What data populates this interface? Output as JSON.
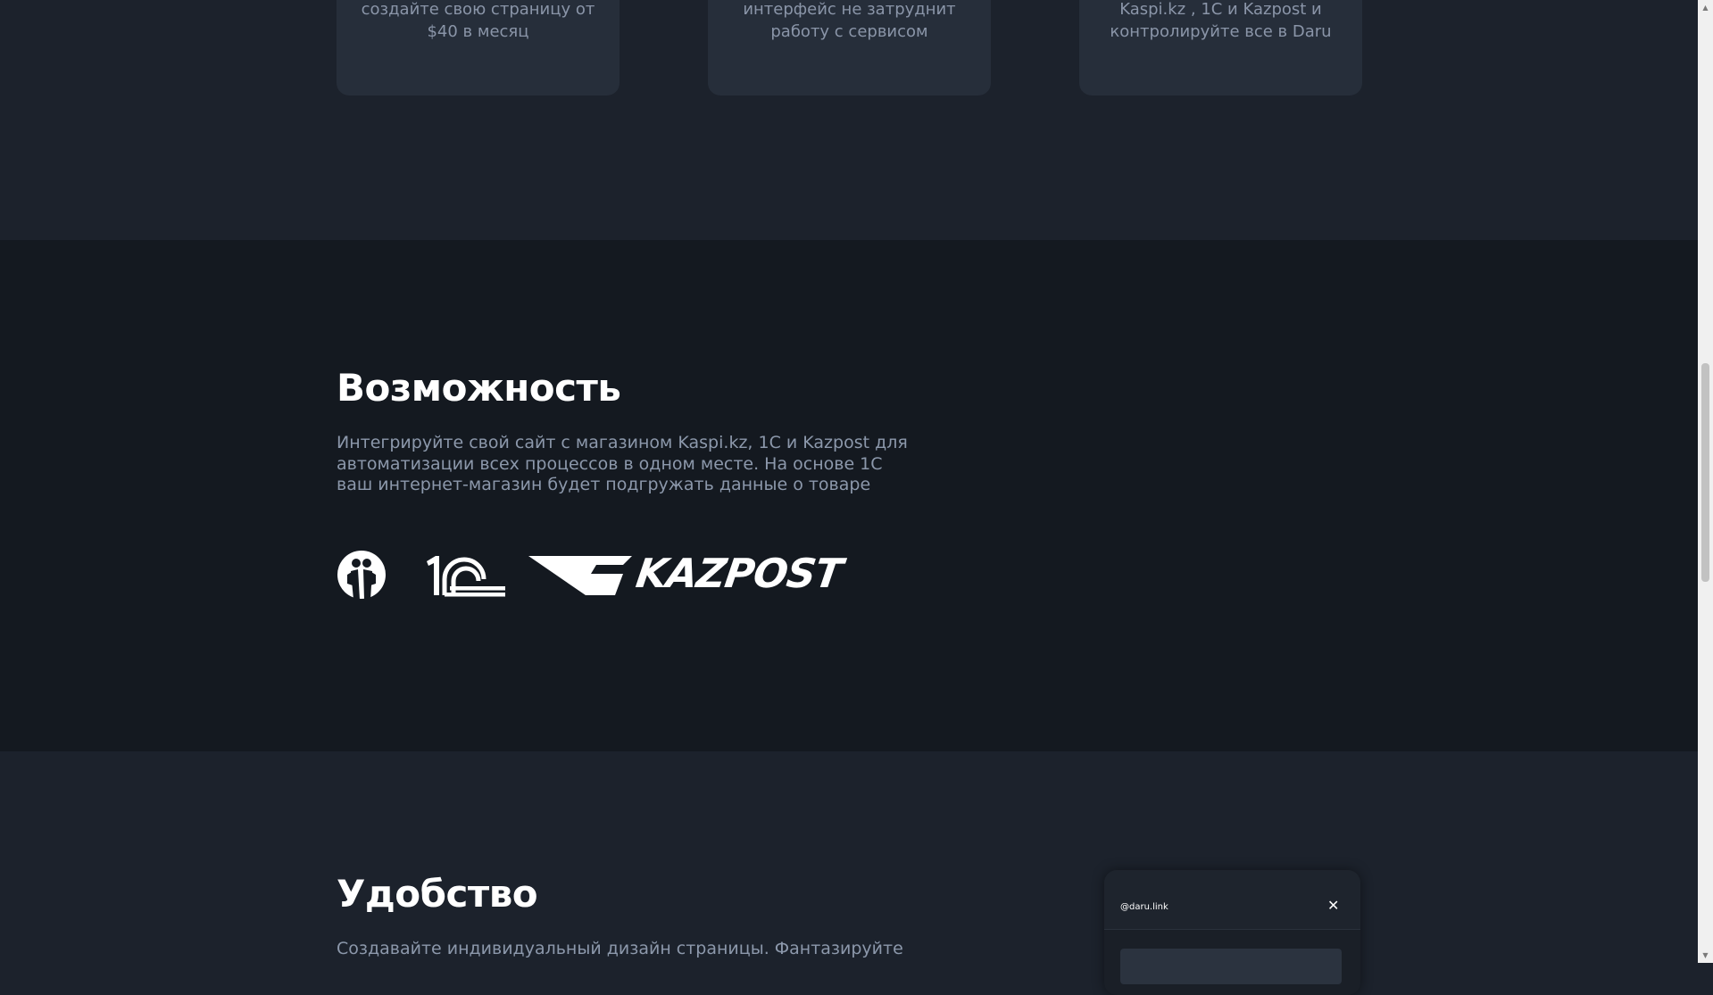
{
  "features": {
    "cards": [
      {
        "line1": "создайте свою страницу от",
        "line2": "$40 в месяц"
      },
      {
        "line1": "интерфейс не затруднит",
        "line2": "работу с сервисом"
      },
      {
        "line1": "Kaspi.kz , 1С и Kazpost и",
        "line2": "контролируйте все в Daru"
      }
    ]
  },
  "capability": {
    "title": "Возможность",
    "text": "Интегрируйте свой сайт с магазином Kaspi.kz, 1С и Kazpost для автоматизации всех процессов в одном месте. На основе 1С ваш интернет-магазин будет подгружать данные о товаре",
    "logos": {
      "kaspi_icon": "kaspi-logo",
      "onec_icon": "1c-logo",
      "kazpost_text": "KAZPOST"
    }
  },
  "convenience": {
    "title": "Удобство",
    "text": "Создавайте индивидуальный дизайн страницы. Фантазируйте"
  },
  "popup": {
    "url": "@daru.link",
    "close_label": "✕"
  },
  "scrollbar": {
    "up": "▲",
    "down": "▼"
  },
  "colors": {
    "page_bg": "#1c222c",
    "section_bg": "#141920",
    "card_bg": "#262e3a",
    "body_text": "#8c98ab",
    "title_text": "#ffffff"
  }
}
